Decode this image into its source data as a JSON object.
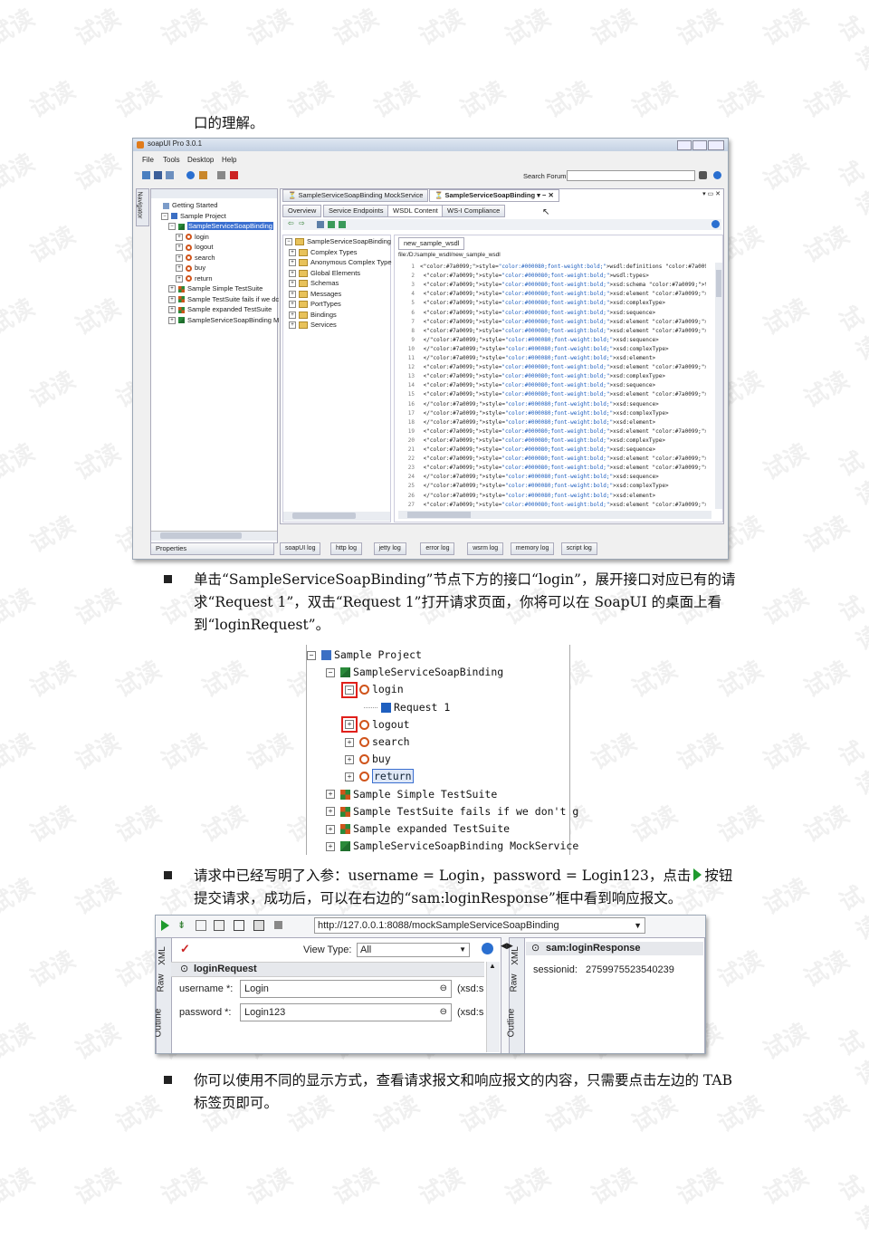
{
  "doc": {
    "intro_line": "口的理解。",
    "bullet1": "单击“SampleServiceSoapBinding”节点下方的接口“login”，展开接口对应已有的请求“Request 1”，双击“Request 1”打开请求页面，你将可以在 SoapUI 的桌面上看到“loginRequest”。",
    "bullet2a": "请求中已经写明了入参：username = Login，password = Login123，点击",
    "bullet2b": "按钮提交请求，成功后，可以在右边的“sam:loginResponse”框中看到响应报文。",
    "bullet3": "你可以使用不同的显示方式，查看请求报文和响应报文的内容，只需要点击左边的 TAB 标签页即可。",
    "watermark": "试读"
  },
  "shot1": {
    "title": "soapUI Pro 3.0.1",
    "menu": [
      "File",
      "Tools",
      "Desktop",
      "Help"
    ],
    "search_label": "Search Forum",
    "navigator_tab": "Navigator",
    "tree": [
      {
        "label": "Getting Started",
        "indent": 0,
        "pm": "",
        "icon": "doc"
      },
      {
        "label": "Sample Project",
        "indent": 1,
        "pm": "−",
        "icon": "project"
      },
      {
        "label": "SampleServiceSoapBinding",
        "indent": 2,
        "pm": "−",
        "icon": "interface",
        "selected": true
      },
      {
        "label": "login",
        "indent": 3,
        "pm": "+",
        "icon": "op"
      },
      {
        "label": "logout",
        "indent": 3,
        "pm": "+",
        "icon": "op"
      },
      {
        "label": "search",
        "indent": 3,
        "pm": "+",
        "icon": "op"
      },
      {
        "label": "buy",
        "indent": 3,
        "pm": "+",
        "icon": "op"
      },
      {
        "label": "return",
        "indent": 3,
        "pm": "+",
        "icon": "op"
      },
      {
        "label": "Sample Simple TestSuite",
        "indent": 2,
        "pm": "+",
        "icon": "suite"
      },
      {
        "label": "Sample TestSuite fails if we dc",
        "indent": 2,
        "pm": "+",
        "icon": "suite"
      },
      {
        "label": "Sample expanded TestSuite",
        "indent": 2,
        "pm": "+",
        "icon": "suite"
      },
      {
        "label": "SampleServiceSoapBinding M",
        "indent": 2,
        "pm": "+",
        "icon": "interface"
      }
    ],
    "properties_tab": "Properties",
    "doc_tabs": [
      "SampleServiceSoapBinding MockService",
      "SampleServiceSoapBinding"
    ],
    "sub_tabs": [
      "Overview",
      "Service Endpoints",
      "WSDL Content",
      "WS-I Compliance"
    ],
    "wsdl_tree": [
      {
        "label": "SampleServiceSoapBinding",
        "pm": "−"
      },
      {
        "label": "Complex Types",
        "pm": "+"
      },
      {
        "label": "Anonymous Complex Type",
        "pm": "+"
      },
      {
        "label": "Global Elements",
        "pm": "+"
      },
      {
        "label": "Schemas",
        "pm": "+"
      },
      {
        "label": "Messages",
        "pm": "+"
      },
      {
        "label": "PortTypes",
        "pm": "+"
      },
      {
        "label": "Bindings",
        "pm": "+"
      },
      {
        "label": "Services",
        "pm": "+"
      }
    ],
    "file_tab": "new_sample_wsdl",
    "file_path": "file:/D:/sample_wsdl/new_sample_wsdl",
    "code": [
      "<wsdl:definitions name=\"sample\" targetNamespace=\"http://www.soapui.org/",
      "  <wsdl:types>",
      "    <xsd:schema targetNamespace=\"http://www.soapui.org/sample/\">",
      "      <xsd:element name=\"loginRequest\">",
      "        <xsd:complexType>",
      "          <xsd:sequence>",
      "            <xsd:element name=\"username\" type=\"xsd:string\"/>",
      "            <xsd:element name=\"password\" type=\"xsd:string\"/>",
      "          </xsd:sequence>",
      "        </xsd:complexType>",
      "      </xsd:element>",
      "      <xsd:element name=\"loginResponse\">",
      "        <xsd:complexType>",
      "          <xsd:sequence>",
      "            <xsd:element name=\"sessionid\" type=\"xsd:string\"/>",
      "          </xsd:sequence>",
      "        </xsd:complexType>",
      "      </xsd:element>",
      "      <xsd:element name=\"searchRequest\">",
      "        <xsd:complexType>",
      "          <xsd:sequence>",
      "            <xsd:element name=\"sessionid\" type=\"xsd:string\"/>",
      "            <xsd:element name=\"searchstring\" type=\"xsd:string\"/>",
      "          </xsd:sequence>",
      "        </xsd:complexType>",
      "      </xsd:element>",
      "      <xsd:element name=\"searchResponse\">"
    ],
    "log_tabs": [
      "soapUI log",
      "http log",
      "jetty log",
      "error log",
      "wsrm log",
      "memory log",
      "script log"
    ]
  },
  "shot2": {
    "rows": [
      {
        "label": "Sample Project",
        "indent": 0,
        "pm": "−",
        "icon": "project"
      },
      {
        "label": "SampleServiceSoapBinding",
        "indent": 1,
        "pm": "−",
        "icon": "interface"
      },
      {
        "label": "login",
        "indent": 2,
        "pm": "−",
        "icon": "op",
        "boxed": true
      },
      {
        "label": "Request 1",
        "indent": 3,
        "pm": "",
        "icon": "request"
      },
      {
        "label": "logout",
        "indent": 2,
        "pm": "+",
        "icon": "op",
        "boxed": true
      },
      {
        "label": "search",
        "indent": 2,
        "pm": "+",
        "icon": "op"
      },
      {
        "label": "buy",
        "indent": 2,
        "pm": "+",
        "icon": "op"
      },
      {
        "label": "return",
        "indent": 2,
        "pm": "+",
        "icon": "op",
        "selected": true
      },
      {
        "label": "Sample Simple TestSuite",
        "indent": 1,
        "pm": "+",
        "icon": "suite"
      },
      {
        "label": "Sample TestSuite fails if we don't g",
        "indent": 1,
        "pm": "+",
        "icon": "suite"
      },
      {
        "label": "Sample expanded TestSuite",
        "indent": 1,
        "pm": "+",
        "icon": "suite"
      },
      {
        "label": "SampleServiceSoapBinding MockService",
        "indent": 1,
        "pm": "+",
        "icon": "interface"
      }
    ]
  },
  "shot3": {
    "endpoint": "http://127.0.0.1:8088/mockSampleServiceSoapBinding",
    "view_type_label": "View Type:",
    "view_type_value": "All",
    "side_tabs_left": [
      "XML",
      "Raw",
      "Outline"
    ],
    "side_tabs_right": [
      "XML",
      "Raw",
      "Outline"
    ],
    "request_node": "loginRequest",
    "fields": [
      {
        "label": "username *:",
        "value": "Login",
        "type": "(xsd:s"
      },
      {
        "label": "password *:",
        "value": "Login123",
        "type": "(xsd:s"
      }
    ],
    "response_node": "sam:loginResponse",
    "response_key": "sessionid:",
    "response_value": "2759975523540239"
  },
  "colors": {
    "selection": "#3a6fd0",
    "keyword": "#000080",
    "attr": "#7a0099",
    "string": "#1f5fbf",
    "red_box": "#e0201b",
    "green_play": "#1f9a2e"
  }
}
